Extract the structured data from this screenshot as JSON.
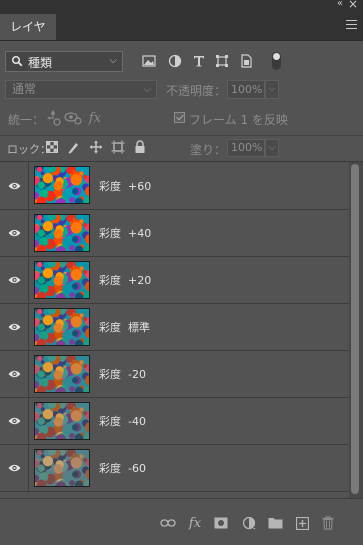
{
  "window": {
    "collapse_glyph": "«",
    "close_glyph": "×"
  },
  "tab": {
    "label": "レイヤー"
  },
  "filter": {
    "kind_label": "種類",
    "icons": [
      "image-filter-icon",
      "adjustment-filter-icon",
      "type-filter-icon",
      "shape-filter-icon",
      "smart-object-filter-icon",
      "filter-toggle-icon"
    ]
  },
  "blend": {
    "mode": "通常",
    "opacity_label": "不透明度：",
    "opacity_value": "100%"
  },
  "unify": {
    "label": "統一：",
    "propagate_label": "フレーム 1 を反映",
    "propagate_checked": true
  },
  "lock": {
    "label": "ロック：",
    "fill_label": "塗り：",
    "fill_value": "100%"
  },
  "layers": [
    {
      "name": "彩度  +60",
      "visible": true,
      "saturation_level": 1.6
    },
    {
      "name": "彩度  +40",
      "visible": true,
      "saturation_level": 1.4
    },
    {
      "name": "彩度  +20",
      "visible": true,
      "saturation_level": 1.2
    },
    {
      "name": "彩度  標準",
      "visible": true,
      "saturation_level": 1.0
    },
    {
      "name": "彩度  -20",
      "visible": true,
      "saturation_level": 0.8
    },
    {
      "name": "彩度  -40",
      "visible": true,
      "saturation_level": 0.6
    },
    {
      "name": "彩度  -60",
      "visible": true,
      "saturation_level": 0.4
    }
  ],
  "bottom_bar": {
    "icons": [
      "link-layers-icon",
      "layer-style-icon",
      "add-mask-icon",
      "adjustment-layer-icon",
      "new-group-icon",
      "new-layer-icon",
      "delete-layer-icon"
    ]
  },
  "colors": {
    "panel_bg": "#535353",
    "text": "#e2e2e2",
    "disabled_text": "#8c8c8c"
  }
}
